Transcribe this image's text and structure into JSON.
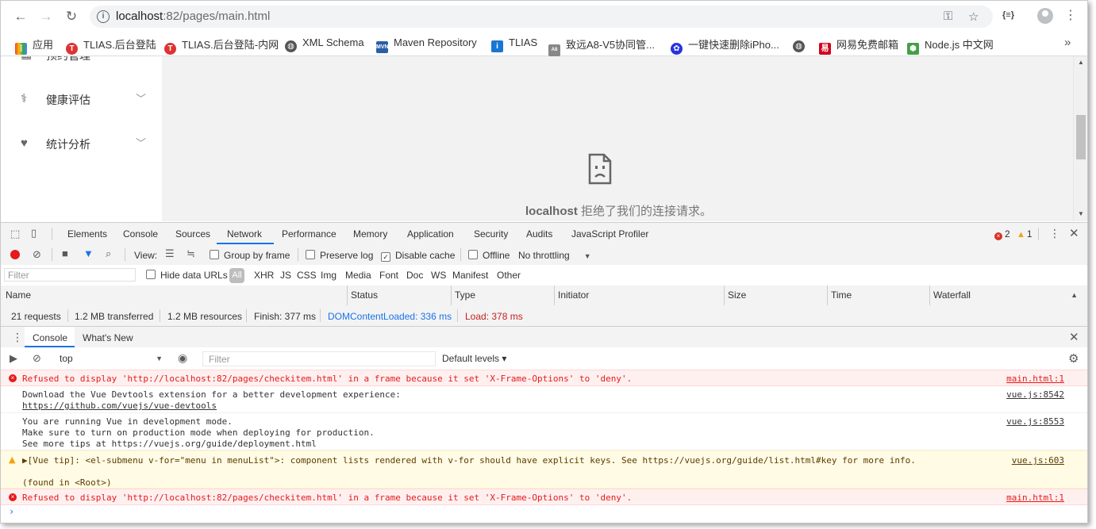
{
  "browser": {
    "url_host": "localhost",
    "url_path": ":82/pages/main.html",
    "ext_label": "{≡}"
  },
  "bookmarks": [
    {
      "label": "应用",
      "icon": "apps-grid-icon",
      "color": "#4285f4"
    },
    {
      "label": "TLIAS.后台登陆",
      "icon": "tlias-logo-icon",
      "color": "#d33"
    },
    {
      "label": "TLIAS.后台登陆-内网",
      "icon": "tlias-logo-icon",
      "color": "#d33"
    },
    {
      "label": "XML Schema",
      "icon": "globe-icon",
      "color": "#555"
    },
    {
      "label": "Maven Repository",
      "icon": "mvn-icon",
      "color": "#2a5fa8"
    },
    {
      "label": "TLIAS",
      "icon": "info-icon",
      "color": "#1976d2"
    },
    {
      "label": "致远A8-V5协同管...",
      "icon": "seeyon-icon",
      "color": "#666"
    },
    {
      "label": "一键快速删除iPho...",
      "icon": "baidu-paw-icon",
      "color": "#2932e1"
    },
    {
      "label": "",
      "icon": "globe-icon",
      "color": "#555"
    },
    {
      "label": "网易免费邮箱",
      "icon": "netease-icon",
      "color": "#d0021b"
    },
    {
      "label": "Node.js 中文网",
      "icon": "nodejs-icon",
      "color": "#43a047"
    }
  ],
  "sidebar": {
    "items": [
      {
        "label": "预约管理"
      },
      {
        "label": "健康评估"
      },
      {
        "label": "统计分析"
      }
    ]
  },
  "page_error": {
    "host": "localhost",
    "message": " 拒绝了我们的连接请求。"
  },
  "devtools": {
    "tabs": [
      "Elements",
      "Console",
      "Sources",
      "Network",
      "Performance",
      "Memory",
      "Application",
      "Security",
      "Audits",
      "JavaScript Profiler"
    ],
    "active_tab": "Network",
    "error_count": "2",
    "warning_count": "1",
    "toolbar": {
      "view_label": "View:",
      "group_by_frame": "Group by frame",
      "preserve_log": "Preserve log",
      "disable_cache": "Disable cache",
      "offline": "Offline",
      "throttling": "No throttling"
    },
    "filter_placeholder": "Filter",
    "hide_data_urls": "Hide data URLs",
    "type_filters": [
      "All",
      "XHR",
      "JS",
      "CSS",
      "Img",
      "Media",
      "Font",
      "Doc",
      "WS",
      "Manifest",
      "Other"
    ],
    "columns": [
      "Name",
      "Status",
      "Type",
      "Initiator",
      "Size",
      "Time",
      "Waterfall"
    ],
    "summary": {
      "requests": "21 requests",
      "transferred": "1.2 MB transferred",
      "resources": "1.2 MB resources",
      "finish": "Finish: 377 ms",
      "dcl": "DOMContentLoaded: 336 ms",
      "load": "Load: 378 ms"
    },
    "drawer_tabs": [
      "Console",
      "What's New"
    ],
    "console": {
      "context": "top",
      "filter_placeholder": "Filter",
      "levels": "Default levels ▾",
      "messages": [
        {
          "type": "error",
          "lines": [
            "Refused to display 'http://localhost:82/pages/checkitem.html' in a frame because it set 'X-Frame-Options' to 'deny'."
          ],
          "source": "main.html:1"
        },
        {
          "type": "log",
          "lines": [
            "Download the Vue Devtools extension for a better development experience:",
            "https://github.com/vuejs/vue-devtools"
          ],
          "source": "vue.js:8542"
        },
        {
          "type": "log",
          "lines": [
            "You are running Vue in development mode.",
            "Make sure to turn on production mode when deploying for production.",
            "See more tips at https://vuejs.org/guide/deployment.html"
          ],
          "source": "vue.js:8553"
        },
        {
          "type": "warn",
          "lines": [
            "▶[Vue tip]: <el-submenu v-for=\"menu in menuList\">: component lists rendered with v-for should have explicit keys. See https://vuejs.org/guide/list.html#key for more info.",
            "",
            "(found in <Root>)"
          ],
          "source": "vue.js:603"
        },
        {
          "type": "error",
          "lines": [
            "Refused to display 'http://localhost:82/pages/checkitem.html' in a frame because it set 'X-Frame-Options' to 'deny'."
          ],
          "source": "main.html:1"
        }
      ]
    }
  }
}
